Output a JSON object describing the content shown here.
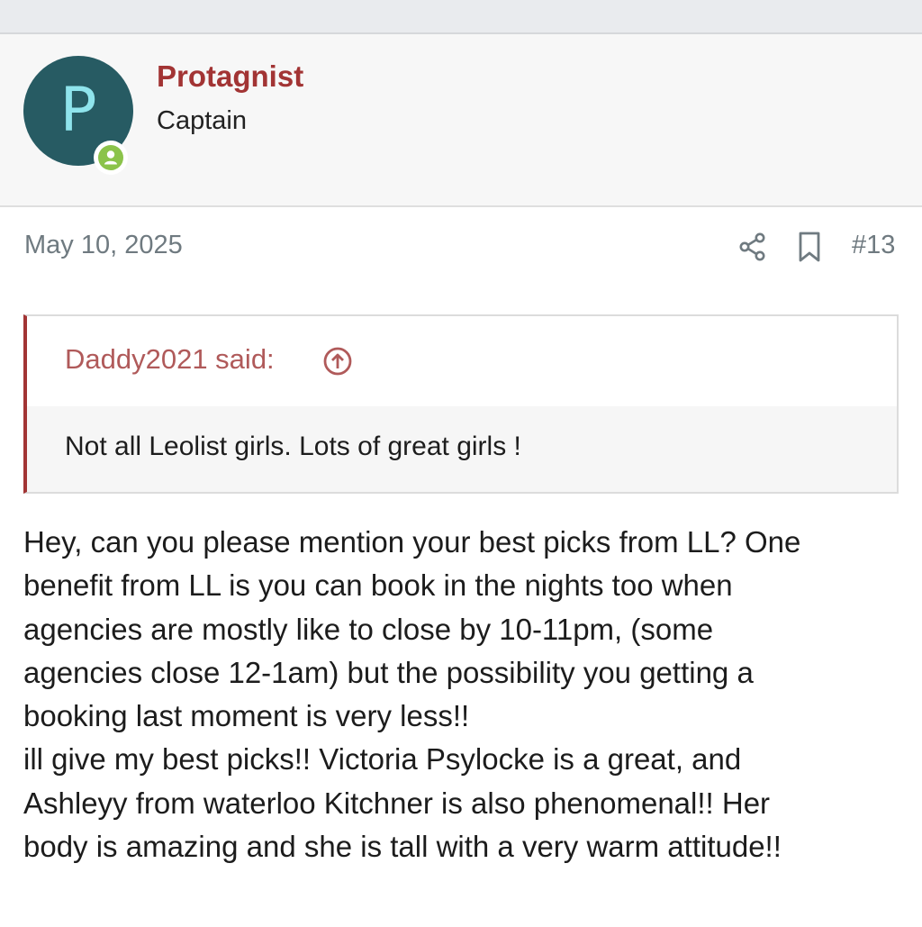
{
  "author": {
    "avatar_letter": "P",
    "avatar_color": "#275b63",
    "username": "Protagnist",
    "user_title": "Captain",
    "status_icon": "online-user-icon",
    "status_color": "#8bc34a"
  },
  "post": {
    "date": "May 10, 2025",
    "number": "#13",
    "share_icon": "share-icon",
    "bookmark_icon": "bookmark-icon"
  },
  "quote": {
    "author_label": "Daddy2021 said:",
    "jump_icon": "arrow-up-circle-icon",
    "text": "Not all Leolist girls. Lots of great girls !"
  },
  "body": {
    "lines": [
      "Hey, can you please mention your best picks from LL? One",
      "benefit from LL is you can book in the nights too when",
      "agencies are mostly like to close by 10-11pm, (some",
      "agencies close 12-1am) but the possibility you getting a",
      "booking last moment is very less!!",
      "ill give my best picks!! Victoria Psylocke is a great, and",
      "Ashleyy from waterloo Kitchner is also phenomenal!! Her",
      "body is amazing and she is tall with a very warm attitude!!"
    ]
  },
  "colors": {
    "accent": "#a23434",
    "quote_author": "#b05a5a",
    "muted": "#6f7a80"
  }
}
